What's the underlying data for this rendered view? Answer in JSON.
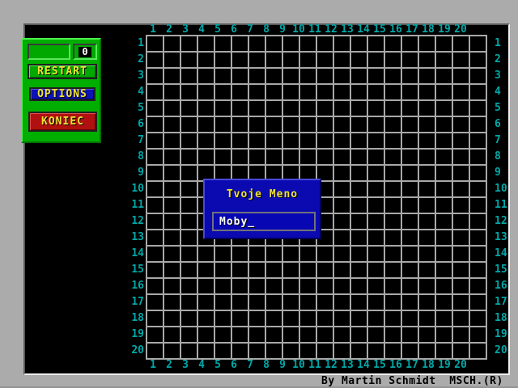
{
  "window": {
    "credit": "By Martin Schmidt  MSCH.(R)"
  },
  "scoreboard": {
    "score": "0"
  },
  "buttons": {
    "restart": "RESTART",
    "options": "OPTIONS",
    "koniec": "KONIEC"
  },
  "board": {
    "rows": 20,
    "cols": 20,
    "col_labels": [
      "1",
      "2",
      "3",
      "4",
      "5",
      "6",
      "7",
      "8",
      "9",
      "10",
      "11",
      "12",
      "13",
      "14",
      "15",
      "16",
      "17",
      "18",
      "19",
      "20"
    ],
    "row_labels": [
      "1",
      "2",
      "3",
      "4",
      "5",
      "6",
      "7",
      "8",
      "9",
      "10",
      "11",
      "12",
      "13",
      "14",
      "15",
      "16",
      "17",
      "18",
      "19",
      "20"
    ],
    "label_color": "#00a8a8",
    "line_color": "#a8a8a8"
  },
  "dialog": {
    "title": "Tvoje Meno",
    "input_value": "Moby_"
  },
  "colors": {
    "frame_gray": "#ababab",
    "panel_green": "#00ae00",
    "button_green": "#00a800",
    "options_blue": "#0c12b6",
    "koniec_red": "#b01010",
    "dialog_blue": "#0a0ab0",
    "accent_yellow": "#f0e236",
    "text_white": "#ffffff"
  }
}
